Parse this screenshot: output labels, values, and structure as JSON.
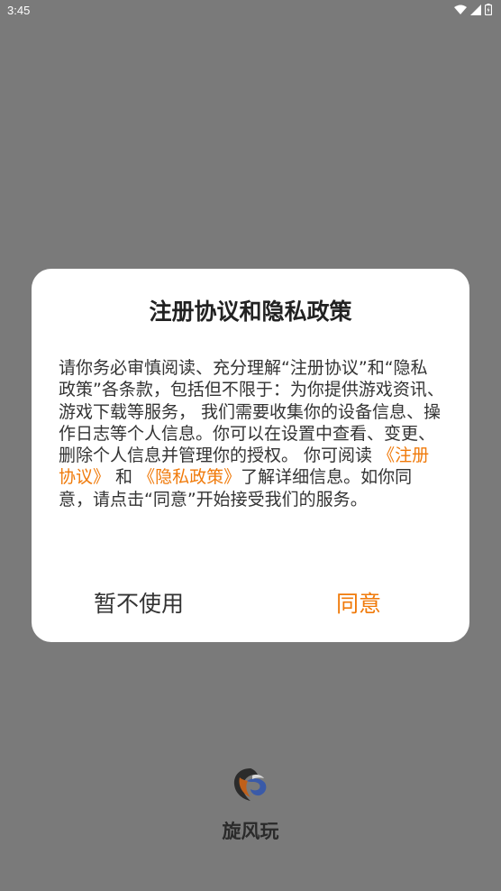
{
  "status_bar": {
    "time": "3:45",
    "icons": [
      "wifi-icon",
      "signal-icon",
      "battery-icon"
    ]
  },
  "dialog": {
    "title": "注册协议和隐私政策",
    "body_before": "请你务必审慎阅读、充分理解“注册协议”和“隐私政策”各条款，包括但不限于：为你提供游戏资讯、游戏下载等服务， 我们需要收集你的设备信息、操作日志等个人信息。你可以在设置中查看、变更、删除个人信息并管理你的授权。 你可阅读 ",
    "link_terms": "《注册协议》",
    "body_and": " 和 ",
    "link_privacy": "《隐私政策》",
    "body_after": "了解详细信息。如你同意，请点击“同意”开始接受我们的服务。",
    "decline_label": "暂不使用",
    "accept_label": "同意"
  },
  "app": {
    "name": "旋风玩",
    "logo_icon": "cyclone-logo-icon"
  },
  "colors": {
    "accent": "#f07a0a",
    "overlay": "#7a7a7a"
  }
}
